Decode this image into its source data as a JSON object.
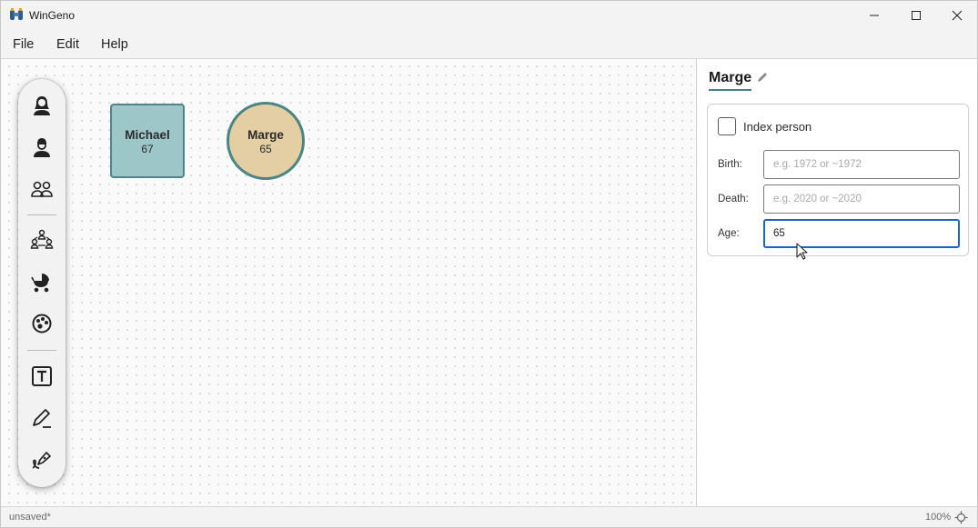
{
  "window": {
    "title": "WinGeno",
    "icon": "app-binoculars-icon"
  },
  "menu": {
    "items": [
      "File",
      "Edit",
      "Help"
    ]
  },
  "toolbar": {
    "tools": [
      {
        "name": "add-female-icon"
      },
      {
        "name": "add-male-icon"
      },
      {
        "name": "add-couple-icon"
      },
      {
        "name": "add-family-icon"
      },
      {
        "name": "add-child-stroller-icon"
      },
      {
        "name": "palette-icon"
      },
      {
        "name": "text-box-icon"
      },
      {
        "name": "pen-icon"
      },
      {
        "name": "signature-icon"
      }
    ]
  },
  "canvas": {
    "nodes": [
      {
        "name": "Michael",
        "age": "67",
        "shape": "square",
        "color": "#9dc6c9"
      },
      {
        "name": "Marge",
        "age": "65",
        "shape": "circle",
        "color": "#e3cfa3"
      }
    ]
  },
  "panel": {
    "title": "Marge",
    "index_person_label": "Index person",
    "birth": {
      "label": "Birth:",
      "value": "",
      "placeholder": "e.g. 1972 or ~1972"
    },
    "death": {
      "label": "Death:",
      "value": "",
      "placeholder": "e.g. 2020 or ~2020"
    },
    "age": {
      "label": "Age:",
      "value": "65",
      "placeholder": ""
    }
  },
  "status": {
    "text": "unsaved*",
    "zoom": "100%"
  },
  "colors": {
    "accent": "#1a64c8",
    "node_border": "#4e8486"
  }
}
